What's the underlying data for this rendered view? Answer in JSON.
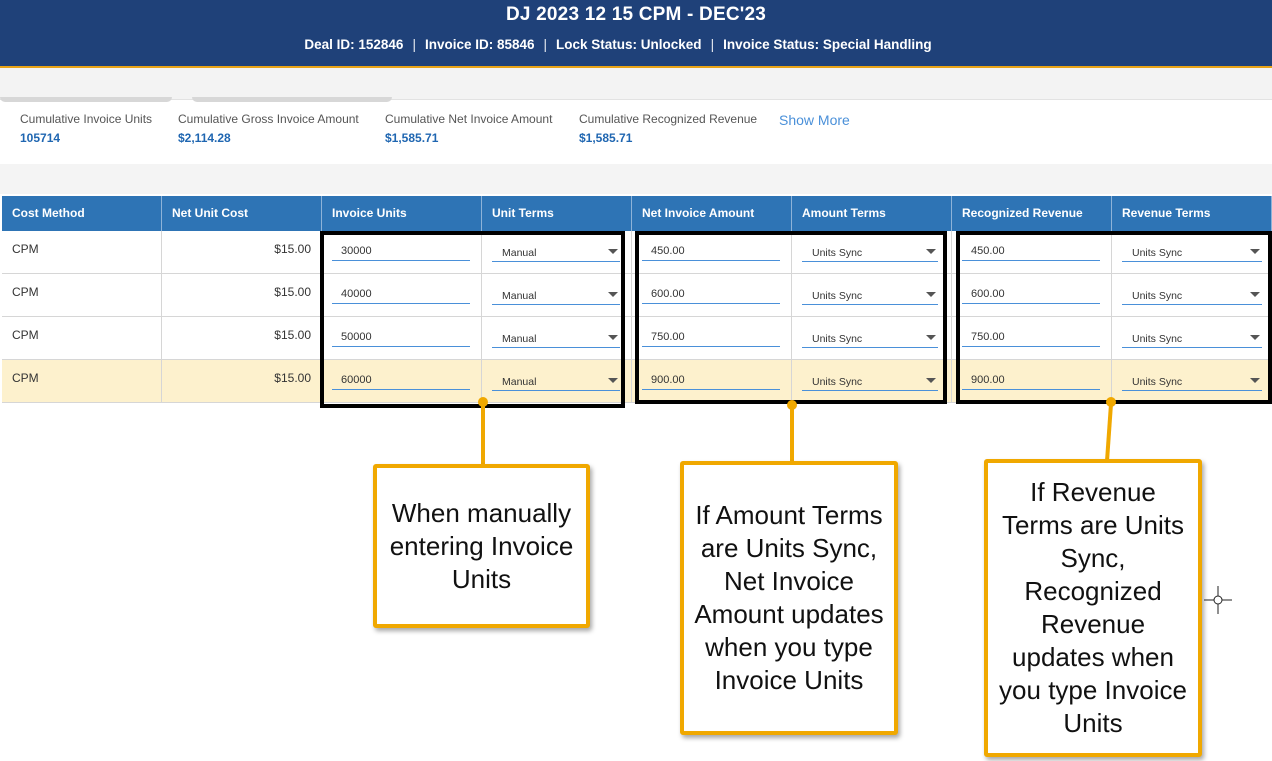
{
  "header": {
    "title": "DJ 2023 12 15 CPM - DEC'23",
    "deal_id": "Deal ID: 152846",
    "invoice_id": "Invoice ID: 85846",
    "lock_status": "Lock Status: Unlocked",
    "invoice_status": "Invoice Status: Special Handling",
    "separator": "|"
  },
  "summary": {
    "items": [
      {
        "label": "Cumulative Invoice Units",
        "value": "105714"
      },
      {
        "label": "Cumulative Gross Invoice Amount",
        "value": "$2,114.28"
      },
      {
        "label": "Cumulative Net Invoice Amount",
        "value": "$1,585.71"
      },
      {
        "label": "Cumulative Recognized Revenue",
        "value": "$1,585.71"
      }
    ],
    "show_more": "Show More"
  },
  "grid": {
    "columns": [
      "Cost Method",
      "Net Unit Cost",
      "Invoice Units",
      "Unit Terms",
      "Net Invoice Amount",
      "Amount Terms",
      "Recognized Revenue",
      "Revenue Terms"
    ],
    "rows": [
      {
        "cost_method": "CPM",
        "net_unit_cost": "$15.00",
        "invoice_units": "30000",
        "unit_terms": "Manual",
        "net_invoice_amount": "450.00",
        "amount_terms": "Units Sync",
        "recognized_revenue": "450.00",
        "revenue_terms": "Units Sync"
      },
      {
        "cost_method": "CPM",
        "net_unit_cost": "$15.00",
        "invoice_units": "40000",
        "unit_terms": "Manual",
        "net_invoice_amount": "600.00",
        "amount_terms": "Units Sync",
        "recognized_revenue": "600.00",
        "revenue_terms": "Units Sync"
      },
      {
        "cost_method": "CPM",
        "net_unit_cost": "$15.00",
        "invoice_units": "50000",
        "unit_terms": "Manual",
        "net_invoice_amount": "750.00",
        "amount_terms": "Units Sync",
        "recognized_revenue": "750.00",
        "revenue_terms": "Units Sync"
      },
      {
        "cost_method": "CPM",
        "net_unit_cost": "$15.00",
        "invoice_units": "60000",
        "unit_terms": "Manual",
        "net_invoice_amount": "900.00",
        "amount_terms": "Units Sync",
        "recognized_revenue": "900.00",
        "revenue_terms": "Units Sync"
      }
    ]
  },
  "callouts": [
    "When manually entering Invoice Units",
    "If Amount Terms are Units Sync, Net Invoice Amount updates when you type Invoice Units",
    "If Revenue Terms are Units Sync, Recognized Revenue updates when you type Invoice Units"
  ],
  "colors": {
    "header_bg": "#1f4179",
    "accent": "#e8a317",
    "grid_header": "#2e74b5",
    "callout_border": "#f0a800",
    "row_highlight": "#fdf1cd",
    "link": "#1f66b1"
  }
}
